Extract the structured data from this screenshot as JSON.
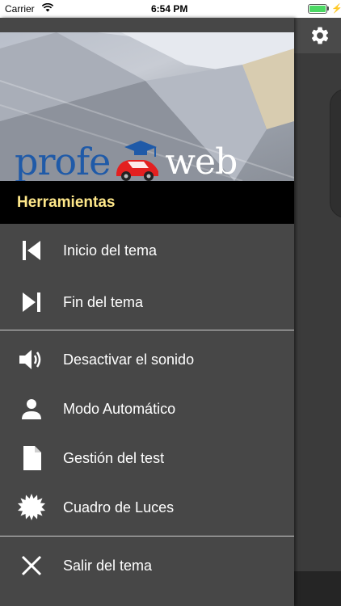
{
  "status_bar": {
    "carrier": "Carrier",
    "time": "6:54 PM",
    "battery_level": 1.0,
    "battery_color": "#4cd964"
  },
  "header": {
    "logo_left": "profe",
    "logo_right": "web",
    "logo_colors": {
      "profe": "#1f5aa8",
      "web": "#ffffff",
      "car": "#e32020",
      "cap": "#1f5aa8"
    }
  },
  "drawer": {
    "section_title": "Herramientas",
    "section_title_color": "#ffe88a",
    "groups": [
      {
        "items": [
          {
            "label": "Inicio del tema",
            "icon": "skip-previous-icon"
          },
          {
            "label": "Fin del tema",
            "icon": "skip-next-icon"
          }
        ]
      },
      {
        "items": [
          {
            "label": "Desactivar el sonido",
            "icon": "volume-icon"
          },
          {
            "label": "Modo Automático",
            "icon": "person-icon"
          },
          {
            "label": "Gestión del test",
            "icon": "document-icon"
          },
          {
            "label": "Cuadro de Luces",
            "icon": "burst-icon"
          }
        ]
      },
      {
        "items": [
          {
            "label": "Salir del tema",
            "icon": "close-icon"
          }
        ]
      }
    ]
  },
  "main": {
    "settings_icon": "gear-icon"
  }
}
